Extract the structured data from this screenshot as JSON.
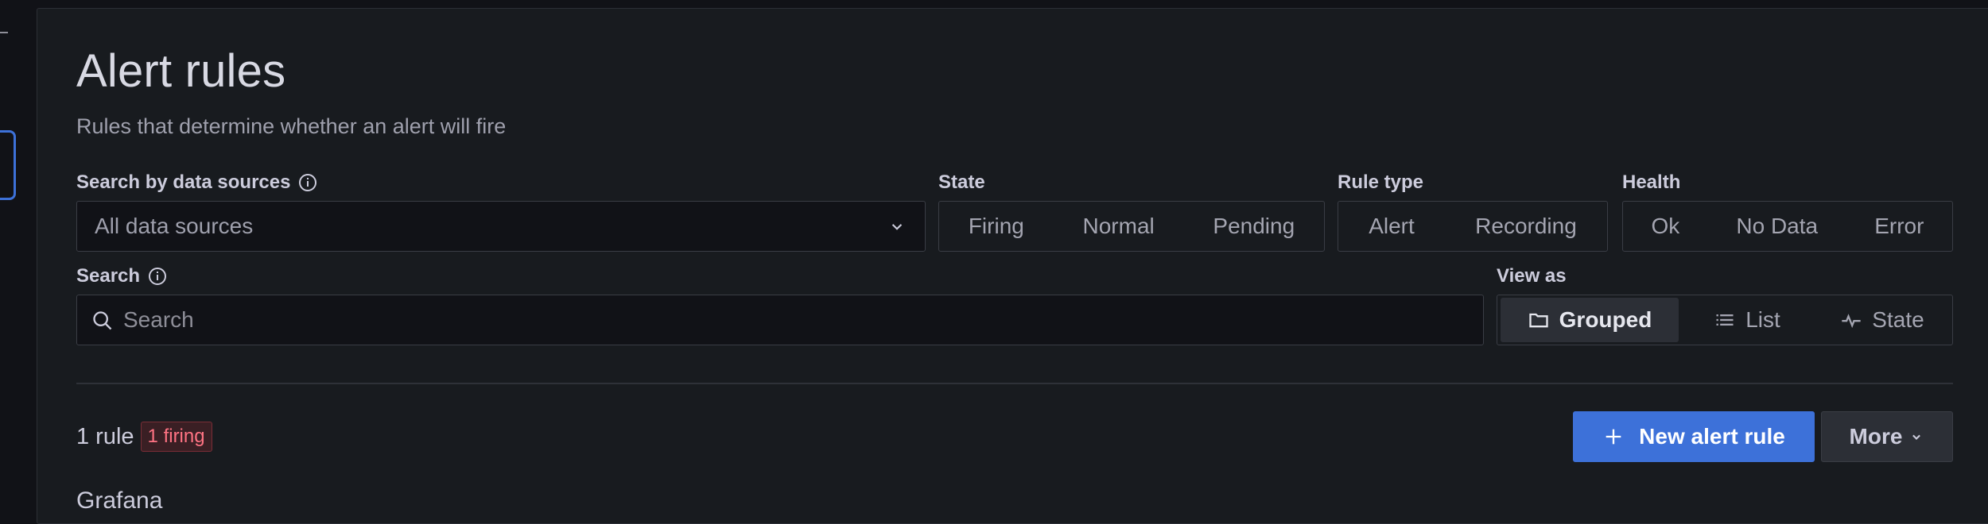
{
  "header": {
    "title": "Alert rules",
    "subtitle": "Rules that determine whether an alert will fire"
  },
  "filters": {
    "datasource_label": "Search by data sources",
    "datasource_value": "All data sources",
    "state_label": "State",
    "state_options": [
      "Firing",
      "Normal",
      "Pending"
    ],
    "rule_type_label": "Rule type",
    "rule_type_options": [
      "Alert",
      "Recording"
    ],
    "health_label": "Health",
    "health_options": [
      "Ok",
      "No Data",
      "Error"
    ],
    "search_label": "Search",
    "search_placeholder": "Search",
    "view_as_label": "View as",
    "view_options": [
      {
        "label": "Grouped",
        "icon": "folder-icon",
        "selected": true
      },
      {
        "label": "List",
        "icon": "list-icon",
        "selected": false
      },
      {
        "label": "State",
        "icon": "heartbeat-icon",
        "selected": false
      }
    ]
  },
  "summary": {
    "rule_count": "1 rule",
    "firing_badge": "1 firing"
  },
  "actions": {
    "new_alert_rule": "New alert rule",
    "more": "More"
  },
  "groups": {
    "first_title": "Grafana"
  },
  "colors": {
    "primary": "#3d71d9",
    "firing": "#ff7383",
    "background": "#181b1f"
  }
}
